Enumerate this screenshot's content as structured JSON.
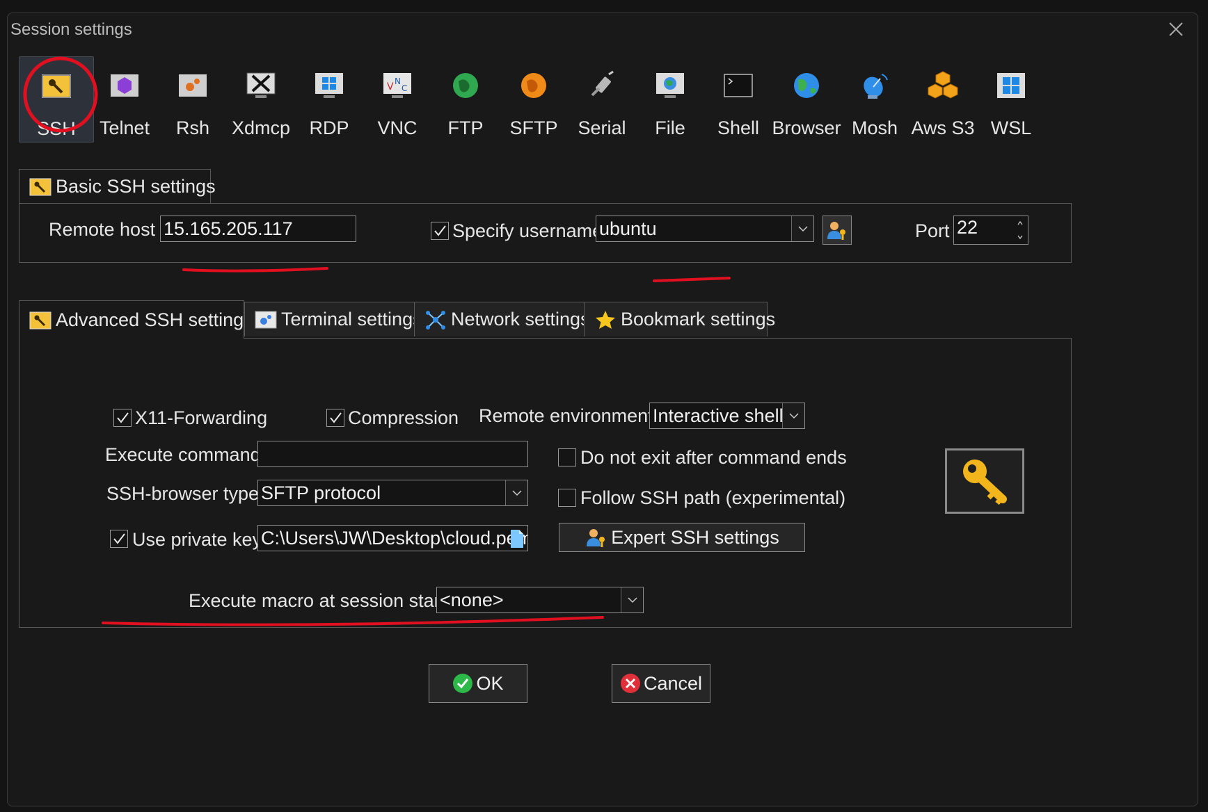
{
  "window": {
    "title": "Session settings"
  },
  "session_types": [
    {
      "label": "SSH",
      "icon": "ssh-key-icon",
      "active": true
    },
    {
      "label": "Telnet",
      "icon": "telnet-icon"
    },
    {
      "label": "Rsh",
      "icon": "rsh-icon"
    },
    {
      "label": "Xdmcp",
      "icon": "xdmcp-icon"
    },
    {
      "label": "RDP",
      "icon": "rdp-icon"
    },
    {
      "label": "VNC",
      "icon": "vnc-icon"
    },
    {
      "label": "FTP",
      "icon": "ftp-globe-icon"
    },
    {
      "label": "SFTP",
      "icon": "sftp-globe-icon"
    },
    {
      "label": "Serial",
      "icon": "serial-plug-icon"
    },
    {
      "label": "File",
      "icon": "file-monitor-icon"
    },
    {
      "label": "Shell",
      "icon": "shell-terminal-icon"
    },
    {
      "label": "Browser",
      "icon": "browser-globe-icon"
    },
    {
      "label": "Mosh",
      "icon": "mosh-satellite-icon"
    },
    {
      "label": "Aws S3",
      "icon": "aws-s3-icon"
    },
    {
      "label": "WSL",
      "icon": "wsl-windows-icon"
    }
  ],
  "basic": {
    "tab_label": "Basic SSH settings",
    "remote_host_label": "Remote host *",
    "remote_host_value": "15.165.205.117",
    "specify_username_label": "Specify username",
    "specify_username_checked": true,
    "username_value": "ubuntu",
    "port_label": "Port",
    "port_value": "22"
  },
  "tabs": {
    "advanced": "Advanced SSH settings",
    "terminal": "Terminal settings",
    "network": "Network settings",
    "bookmark": "Bookmark settings"
  },
  "advanced": {
    "x11_label": "X11-Forwarding",
    "x11_checked": true,
    "compression_label": "Compression",
    "compression_checked": true,
    "remote_env_label": "Remote environment:",
    "remote_env_value": "Interactive shell",
    "execute_command_label": "Execute command:",
    "execute_command_value": "",
    "do_not_exit_label": "Do not exit after command ends",
    "do_not_exit_checked": false,
    "browser_type_label": "SSH-browser type:",
    "browser_type_value": "SFTP protocol",
    "follow_path_label": "Follow SSH path (experimental)",
    "follow_path_checked": false,
    "private_key_label": "Use private key",
    "private_key_checked": true,
    "private_key_value": "C:\\Users\\JW\\Desktop\\cloud.pem",
    "expert_button": "Expert SSH settings",
    "macro_label": "Execute macro at session start:",
    "macro_value": "<none>"
  },
  "buttons": {
    "ok": "OK",
    "cancel": "Cancel"
  },
  "colors": {
    "annotation_red": "#e01020",
    "ok_green": "#2db84a",
    "cancel_red": "#e0303a",
    "key_gold": "#f2b51c"
  }
}
